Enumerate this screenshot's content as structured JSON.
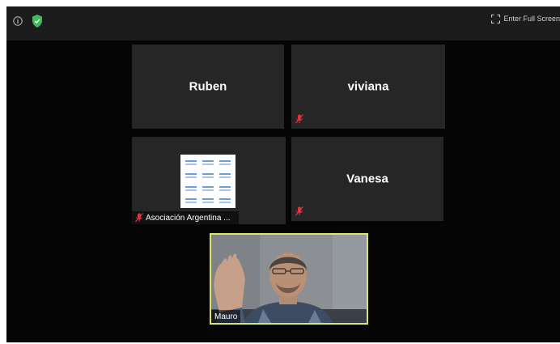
{
  "topbar": {
    "info_icon": "info-icon",
    "security_icon": "shield-icon",
    "fullscreen_label": "Enter Full Screen"
  },
  "participants": [
    {
      "name": "Ruben",
      "muted": false,
      "video": false
    },
    {
      "name": "viviana",
      "muted": true,
      "video": false
    },
    {
      "name": "Asociación Argentina ...",
      "muted": true,
      "video": false,
      "avatar": "logo-image"
    },
    {
      "name": "Vanesa",
      "muted": true,
      "video": false
    },
    {
      "name": "Mauro",
      "muted": false,
      "video": true,
      "active_speaker": true
    }
  ],
  "colors": {
    "background": "#050505",
    "topbar": "#1c1c1c",
    "tile": "#262626",
    "active_speaker_border": "#d8e46a",
    "mute_icon": "#e0353d",
    "security_shield": "#3dbb5d"
  }
}
